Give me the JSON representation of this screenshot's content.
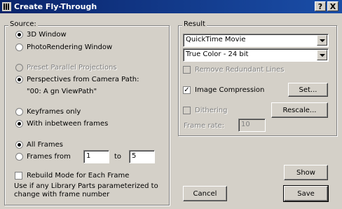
{
  "window": {
    "title": "Create Fly-Through",
    "help_label": "?",
    "close_label": "X"
  },
  "source": {
    "legend": "Source:",
    "view_options": [
      {
        "label": "3D Window",
        "selected": true,
        "enabled": true
      },
      {
        "label": "PhotoRendering Window",
        "selected": false,
        "enabled": true
      }
    ],
    "projection_options": [
      {
        "label": "Preset Parallel Projections",
        "selected": false,
        "enabled": false
      },
      {
        "label": "Perspectives from Camera Path:",
        "selected": true,
        "enabled": true
      }
    ],
    "camera_path_value": "\"00: A gn ViewPath\"",
    "frame_options": [
      {
        "label": "Keyframes only",
        "selected": false
      },
      {
        "label": "With inbetween frames",
        "selected": true
      }
    ],
    "range_options": [
      {
        "label": "All Frames",
        "selected": true
      },
      {
        "label": "Frames from",
        "selected": false
      }
    ],
    "from_value": "1",
    "to_label": "to",
    "to_value": "5",
    "rebuild_label": "Rebuild Mode for Each Frame",
    "rebuild_checked": false,
    "note": "Use if any Library Parts parameterized to change with frame number"
  },
  "result": {
    "legend": "Result",
    "format_value": "QuickTime Movie",
    "color_value": "True Color - 24 bit",
    "remove_lines_label": "Remove Redundant Lines",
    "remove_lines_checked": false,
    "compression_label": "Image Compression",
    "compression_checked": true,
    "set_label": "Set...",
    "dithering_label": "Dithering",
    "dithering_checked": false,
    "rescale_label": "Rescale...",
    "frame_rate_label": "Frame rate:",
    "frame_rate_value": "10"
  },
  "buttons": {
    "show": "Show",
    "cancel": "Cancel",
    "save": "Save"
  }
}
